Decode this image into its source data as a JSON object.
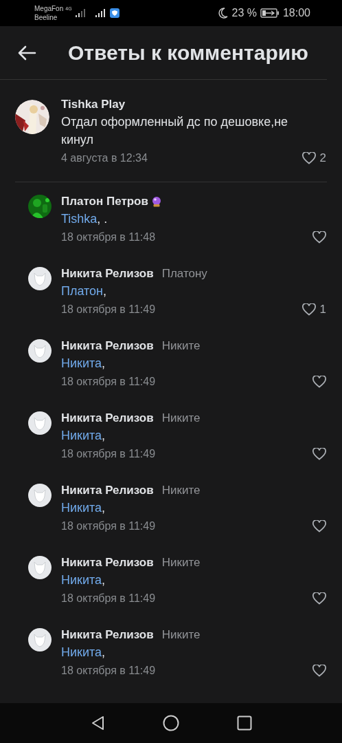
{
  "status_bar": {
    "carriers": [
      "MegaFon",
      "Beeline"
    ],
    "network": "4G",
    "battery": "23 %",
    "time": "18:00"
  },
  "header": {
    "title": "Ответы к комментарию"
  },
  "comment": {
    "author": "Tishka Play",
    "kind": "picture",
    "text": "Отдал оформленный дс по дешовке,не кинул",
    "date": "4 августа в 12:34",
    "likes": "2",
    "liked": false
  },
  "replies": [
    {
      "author": "Платон Петров",
      "kind": "picture",
      "badge_icon": true,
      "mention": "Tishka",
      "text": ", .",
      "date": "18 октября в 11:48",
      "liked": false
    },
    {
      "author": "Никита Релизов",
      "kind": "default",
      "badge_icon": false,
      "reply_to": "Платону",
      "mention": "Платон",
      "text": ",",
      "date": "18 октября в 11:49",
      "likes": "1",
      "liked": false
    },
    {
      "author": "Никита Релизов",
      "kind": "default",
      "badge_icon": false,
      "reply_to": "Никите",
      "mention": "Никита",
      "text": ",",
      "date": "18 октября в 11:49",
      "liked": false
    },
    {
      "author": "Никита Релизов",
      "kind": "default",
      "badge_icon": false,
      "reply_to": "Никите",
      "mention": "Никита",
      "text": ",",
      "date": "18 октября в 11:49",
      "liked": false
    },
    {
      "author": "Никита Релизов",
      "kind": "default",
      "badge_icon": false,
      "reply_to": "Никите",
      "mention": "Никита",
      "text": ",",
      "date": "18 октября в 11:49",
      "liked": false
    },
    {
      "author": "Никита Релизов",
      "kind": "default",
      "badge_icon": false,
      "reply_to": "Никите",
      "mention": "Никита",
      "text": ",",
      "date": "18 октября в 11:49",
      "liked": false
    },
    {
      "author": "Никита Релизов",
      "kind": "default",
      "badge_icon": false,
      "reply_to": "Никите",
      "mention": "Никита",
      "text": ",",
      "date": "18 октября в 11:49",
      "liked": false
    }
  ]
}
